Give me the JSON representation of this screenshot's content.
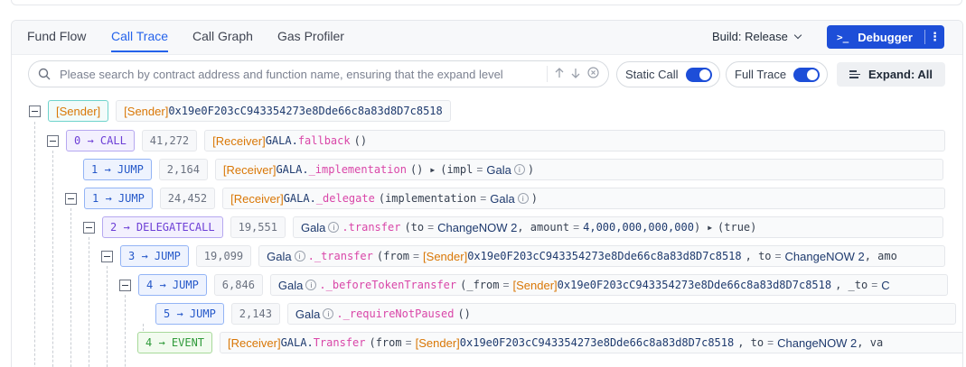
{
  "tabs": [
    {
      "label": "Fund Flow",
      "active": false
    },
    {
      "label": "Call Trace",
      "active": true
    },
    {
      "label": "Call Graph",
      "active": false
    },
    {
      "label": "Gas Profiler",
      "active": false
    }
  ],
  "build": {
    "label": "Build: Release"
  },
  "debugger": {
    "prompt": ">_",
    "label": "Debugger",
    "more": "⋮"
  },
  "search": {
    "placeholder": "Please search by contract address and function name, ensuring that the expand level"
  },
  "toggles": {
    "static_call": "Static Call",
    "full_trace": "Full Trace"
  },
  "expand": {
    "label": "Expand: All"
  },
  "trace": {
    "root": {
      "badge": "[Sender]",
      "tag": "[Sender]",
      "address": "0x19e0F203cC943354273e8Dde66c8a83d8D7c8518"
    },
    "r0": {
      "badge": "0 → CALL",
      "gas": "41,272",
      "tag": "[Receiver]",
      "contract": "GALA.",
      "fn": "fallback",
      "args": "()"
    },
    "r1": {
      "badge": "1 → JUMP",
      "gas": "2,164",
      "tag": "[Receiver]",
      "contract": "GALA.",
      "fn": "_implementation",
      "args": "()",
      "ret_open": "(impl",
      "ret_val": "Gala",
      "ret_close": ")"
    },
    "r2": {
      "badge": "1 → JUMP",
      "gas": "24,452",
      "tag": "[Receiver]",
      "contract": "GALA.",
      "fn": "_delegate",
      "args_open": "(implementation",
      "arg_val": "Gala",
      "args_close": ")"
    },
    "r3": {
      "badge": "2 → DELEGATECALL",
      "gas": "19,551",
      "contract": "Gala",
      "fn": "transfer",
      "p1": "(to",
      "v1": "ChangeNOW 2",
      "p2": ", amount",
      "v2": "4,000,000,000,000",
      "close": ")",
      "ret": "(true)"
    },
    "r4": {
      "badge": "3 → JUMP",
      "gas": "19,099",
      "contract": "Gala",
      "fn": "_transfer",
      "p1": "(from",
      "tag": "[Sender]",
      "address": "0x19e0F203cC943354273e8Dde66c8a83d8D7c8518",
      "p2": ", to",
      "v2": "ChangeNOW 2",
      "p3": ", amo"
    },
    "r5": {
      "badge": "4 → JUMP",
      "gas": "6,846",
      "contract": "Gala",
      "fn": "_beforeTokenTransfer",
      "p1": "(_from",
      "tag": "[Sender]",
      "address": "0x19e0F203cC943354273e8Dde66c8a83d8D7c8518",
      "p2": ", _to",
      "v2": "C"
    },
    "r6": {
      "badge": "5 → JUMP",
      "gas": "2,143",
      "contract": "Gala",
      "fn": "_requireNotPaused",
      "args": "()"
    },
    "r7": {
      "badge": "4 → EVENT",
      "tag": "[Receiver]",
      "contract": "GALA.",
      "fn": "Transfer",
      "p1": "(from",
      "tag2": "[Sender]",
      "address": "0x19e0F203cC943354273e8Dde66c8a83d8D7c8518",
      "p2": ", to",
      "v2": "ChangeNOW 2",
      "p3": ", va"
    }
  }
}
